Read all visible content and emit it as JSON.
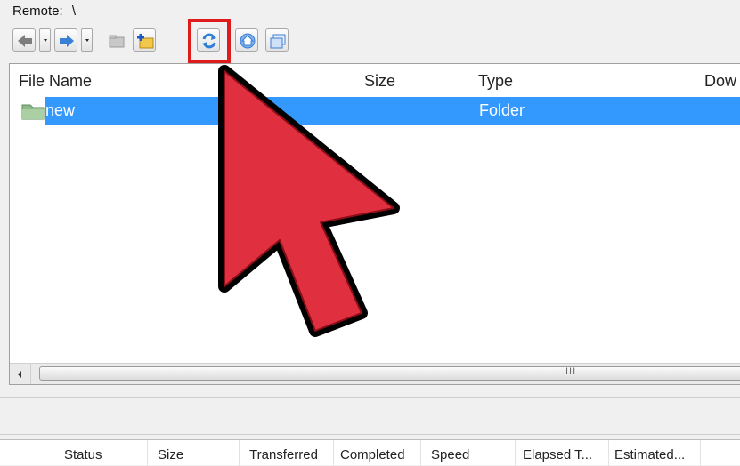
{
  "remote": {
    "label": "Remote:",
    "path": "\\"
  },
  "toolbar": {
    "buttons": [
      {
        "name": "back",
        "icon": "back-arrow-icon"
      },
      {
        "name": "forward",
        "icon": "forward-arrow-icon"
      },
      {
        "name": "up",
        "icon": "parent-folder-icon"
      },
      {
        "name": "new-folder",
        "icon": "new-folder-icon"
      },
      {
        "name": "refresh",
        "icon": "refresh-icon",
        "highlighted": true
      },
      {
        "name": "home",
        "icon": "home-icon"
      },
      {
        "name": "view",
        "icon": "view-icon"
      }
    ]
  },
  "filelist": {
    "columns": [
      "File Name",
      "Size",
      "Type",
      "Dow"
    ],
    "rows": [
      {
        "name": "new",
        "size": "",
        "type": "Folder",
        "selected": true
      }
    ],
    "scroll_grip": "III"
  },
  "queue": {
    "columns": [
      "Status",
      "Size",
      "Transferred",
      "Completed",
      "Speed",
      "Elapsed T...",
      "Estimated..."
    ]
  },
  "colors": {
    "selection": "#3399ff",
    "highlight": "#e01b1b",
    "cursor_fill": "#e0303f"
  }
}
